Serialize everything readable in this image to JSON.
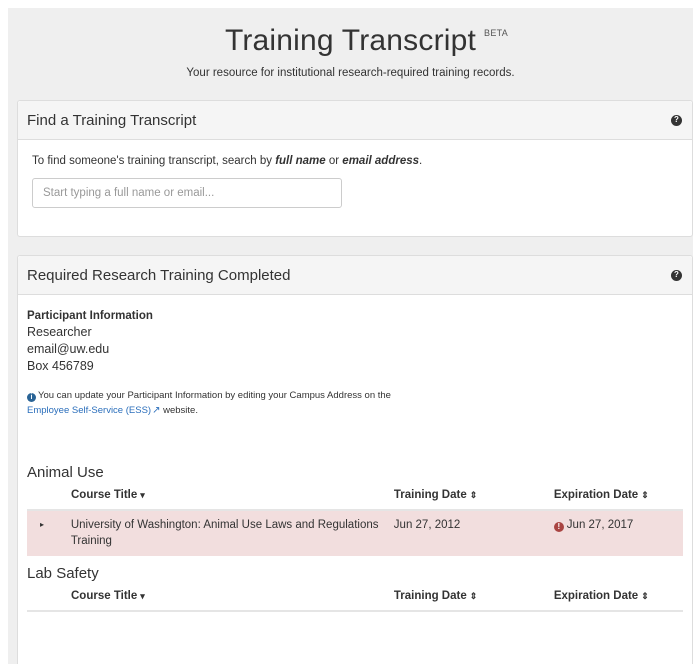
{
  "header": {
    "title": "Training Transcript",
    "badge": "BETA",
    "subtitle": "Your resource for institutional research-required training records."
  },
  "find_panel": {
    "title": "Find a Training Transcript",
    "help_glyph": "?",
    "instructions_prefix": "To find someone's training transcript, search by ",
    "instructions_term1": "full name",
    "instructions_mid": " or ",
    "instructions_term2": "email address",
    "instructions_suffix": ".",
    "search_placeholder": "Start typing a full name or email..."
  },
  "required_panel": {
    "title": "Required Research Training Completed",
    "help_glyph": "?",
    "participant": {
      "heading": "Participant Information",
      "role": "Researcher",
      "email": "email@uw.edu",
      "box": "Box 456789"
    },
    "note": {
      "icon_glyph": "i",
      "text": "You can update your Participant Information by editing your Campus Address on the",
      "link_label": "Employee Self-Service (ESS)",
      "link_icon_glyph": "↗",
      "suffix": "website."
    },
    "columns": {
      "course_title": "Course Title",
      "training_date": "Training Date",
      "expiration_date": "Expiration Date",
      "title_sort_glyph": "▾",
      "date_sort_glyph": "⇕"
    },
    "sections": [
      {
        "title": "Animal Use",
        "rows": [
          {
            "expand_glyph": "▸",
            "course": "University of Washington: Animal Use Laws and Regulations Training",
            "training_date": "Jun 27, 2012",
            "expiration_alert_glyph": "!",
            "expiration_date": "Jun 27, 2017"
          }
        ]
      },
      {
        "title": "Lab Safety",
        "rows": []
      }
    ]
  },
  "colors": {
    "page_bg": "#efefef",
    "expired_row_bg": "#f2dede",
    "alert_red": "#a94442",
    "link_blue": "#2a6ebb"
  }
}
